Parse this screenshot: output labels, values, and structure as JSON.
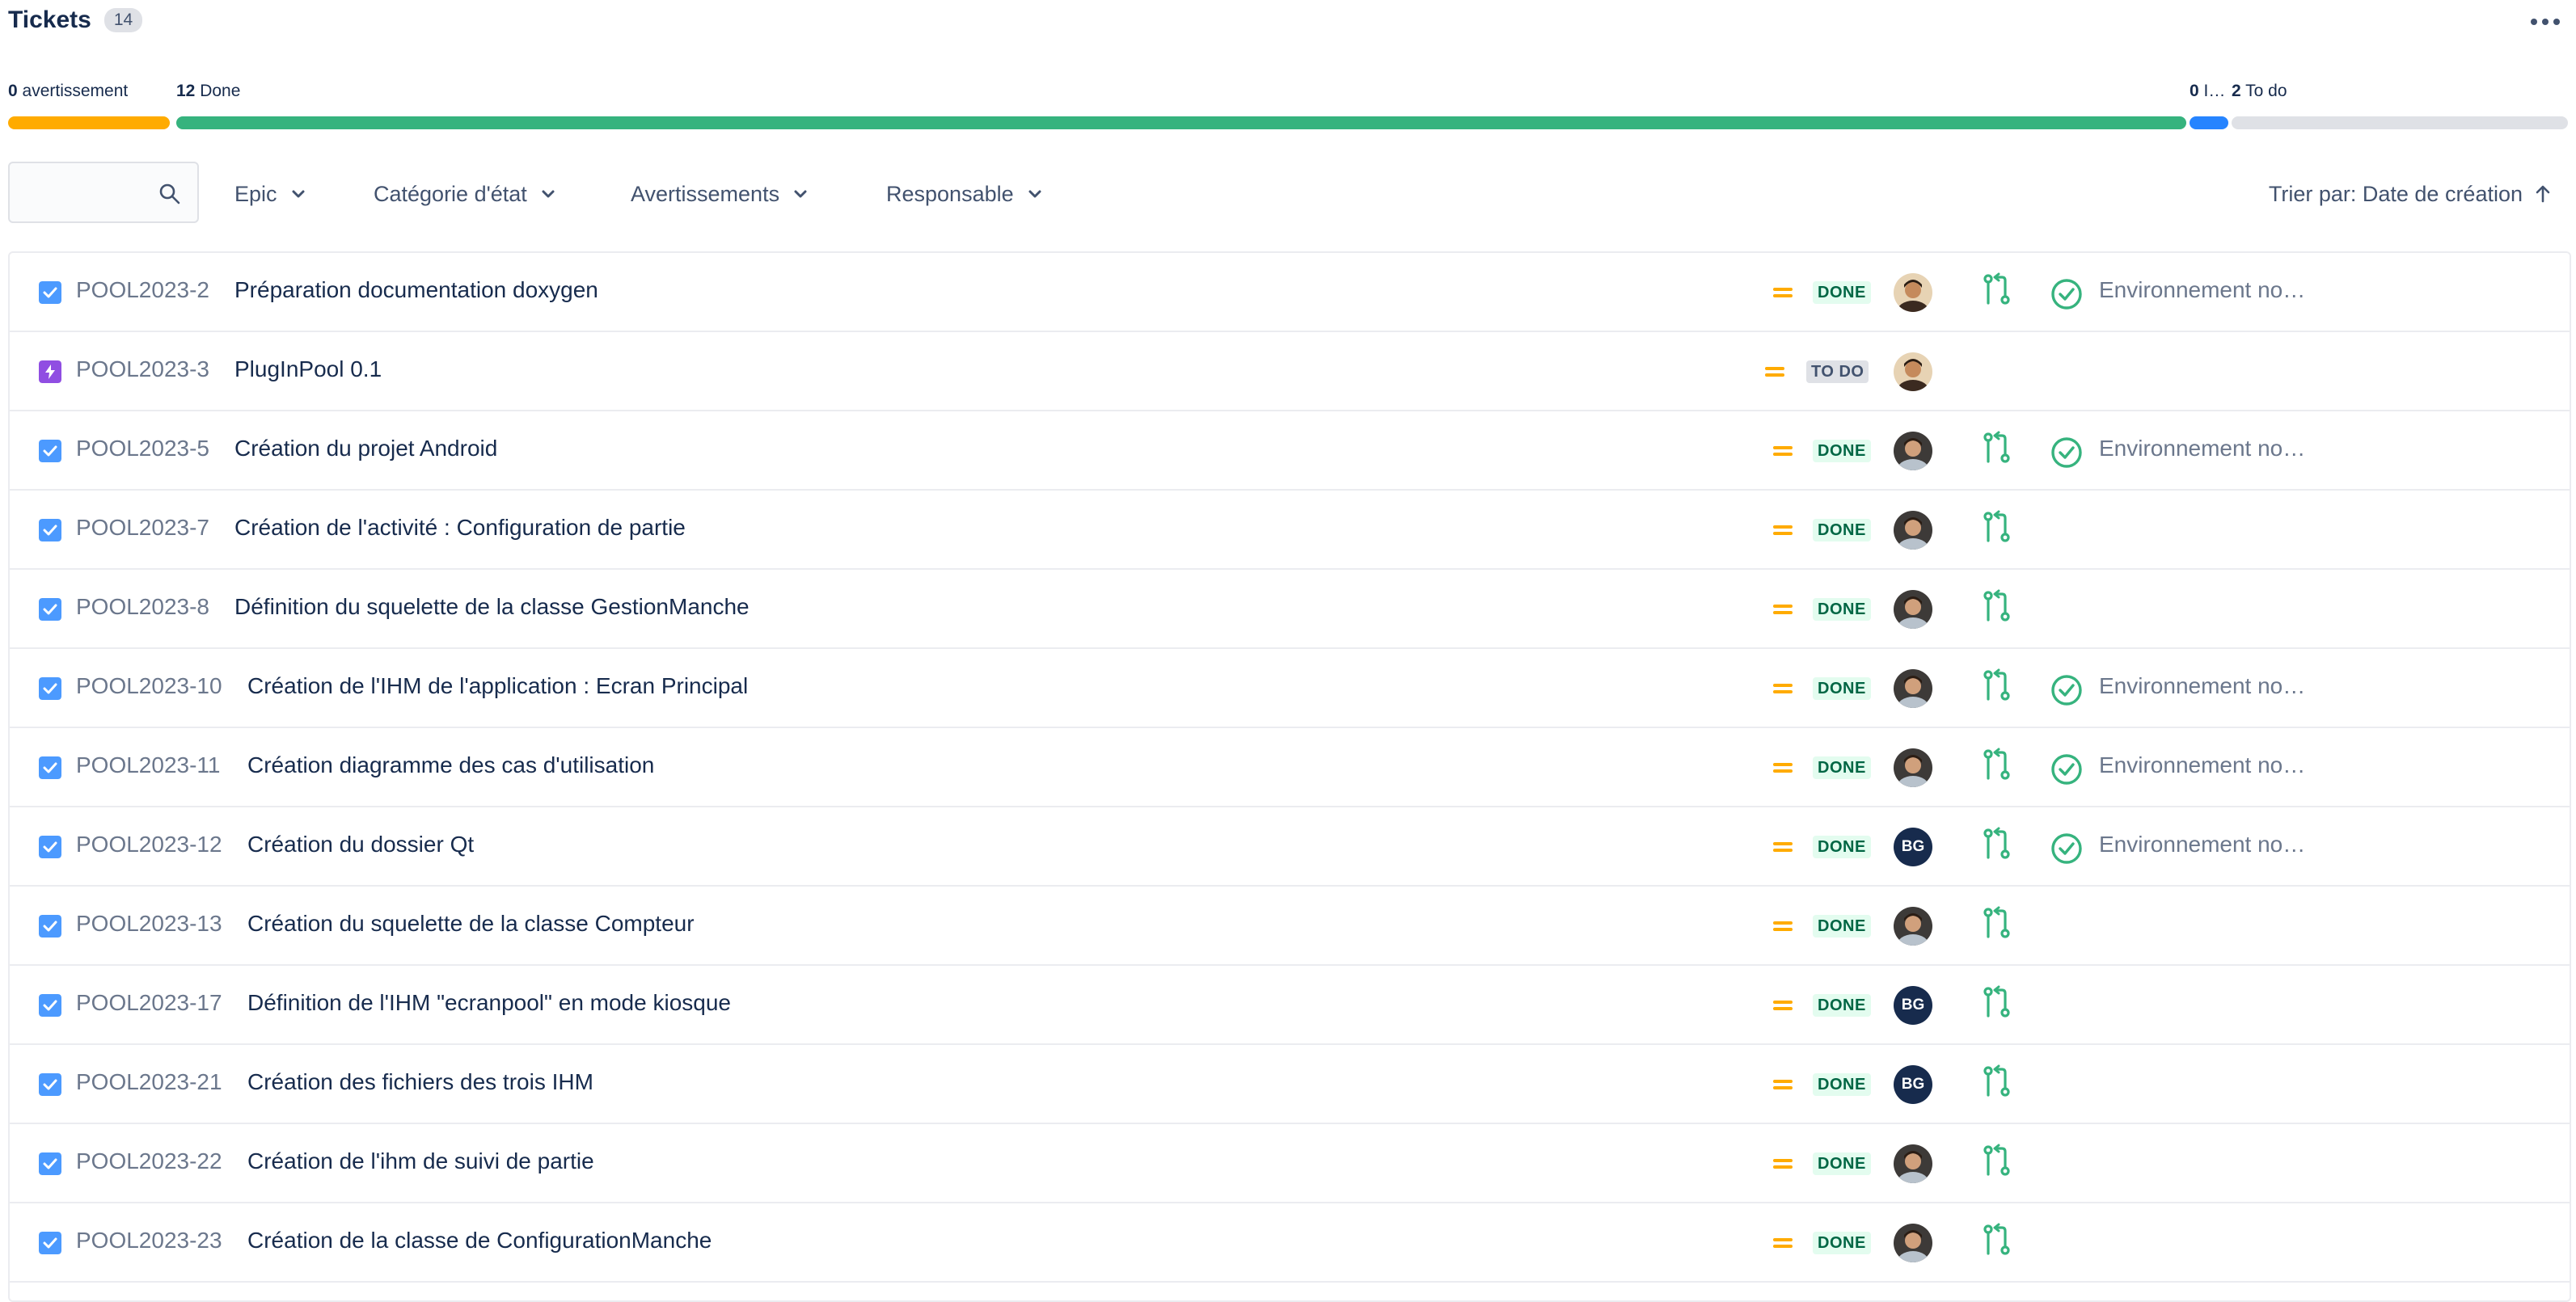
{
  "header": {
    "title": "Tickets",
    "count": "14"
  },
  "progress": {
    "segments": [
      {
        "count": "0",
        "label": "avertissement",
        "color": "#ffab00"
      },
      {
        "count": "12",
        "label": "Done",
        "color": "#36b37e"
      },
      {
        "count": "0",
        "label": "I…",
        "color": "#2684ff"
      },
      {
        "count": "2",
        "label": "To do",
        "color": "#dfe1e6"
      }
    ]
  },
  "filters": {
    "search_placeholder": "",
    "epic": "Epic",
    "state_category": "Catégorie d'état",
    "warnings": "Avertissements",
    "assignee": "Responsable",
    "sort": "Trier par: Date de création"
  },
  "colors": {
    "done_bg": "#e3fcef",
    "done_text": "#006644",
    "priority": "#ffab00",
    "accent_green": "#36b37e",
    "task_blue": "#4c9aff",
    "epic_purple": "#904ee2"
  },
  "tickets": [
    {
      "type": "task",
      "key": "POOL2023-2",
      "summary": "Préparation documentation doxygen",
      "status": "DONE",
      "avatar": "photo-dark",
      "dev": true,
      "env": "Environnement no…"
    },
    {
      "type": "epic",
      "key": "POOL2023-3",
      "summary": "PlugInPool 0.1",
      "status": "TO DO",
      "avatar": "photo-dark",
      "dev": false,
      "env": ""
    },
    {
      "type": "task",
      "key": "POOL2023-5",
      "summary": "Création du projet Android",
      "status": "DONE",
      "avatar": "photo-light",
      "dev": true,
      "env": "Environnement no…"
    },
    {
      "type": "task",
      "key": "POOL2023-7",
      "summary": "Création de l'activité : Configuration de partie",
      "status": "DONE",
      "avatar": "photo-light",
      "dev": true,
      "env": ""
    },
    {
      "type": "task",
      "key": "POOL2023-8",
      "summary": "Définition du squelette de la classe GestionManche",
      "status": "DONE",
      "avatar": "photo-light",
      "dev": true,
      "env": ""
    },
    {
      "type": "task",
      "key": "POOL2023-10",
      "summary": "Création de l'IHM de l'application : Ecran Principal",
      "status": "DONE",
      "avatar": "photo-light",
      "dev": true,
      "env": "Environnement no…"
    },
    {
      "type": "task",
      "key": "POOL2023-11",
      "summary": "Création diagramme des cas d'utilisation",
      "status": "DONE",
      "avatar": "photo-light",
      "dev": true,
      "env": "Environnement no…"
    },
    {
      "type": "task",
      "key": "POOL2023-12",
      "summary": "Création du dossier Qt",
      "status": "DONE",
      "avatar": "BG",
      "dev": true,
      "env": "Environnement no…"
    },
    {
      "type": "task",
      "key": "POOL2023-13",
      "summary": "Création du squelette de la classe Compteur",
      "status": "DONE",
      "avatar": "photo-light",
      "dev": true,
      "env": ""
    },
    {
      "type": "task",
      "key": "POOL2023-17",
      "summary": "Définition de l'IHM \"ecranpool\" en mode kiosque",
      "status": "DONE",
      "avatar": "BG",
      "dev": true,
      "env": ""
    },
    {
      "type": "task",
      "key": "POOL2023-21",
      "summary": "Création des fichiers des trois IHM",
      "status": "DONE",
      "avatar": "BG",
      "dev": true,
      "env": ""
    },
    {
      "type": "task",
      "key": "POOL2023-22",
      "summary": "Création de l'ihm de suivi de partie",
      "status": "DONE",
      "avatar": "photo-light",
      "dev": true,
      "env": ""
    },
    {
      "type": "task",
      "key": "POOL2023-23",
      "summary": "Création de la classe de ConfigurationManche",
      "status": "DONE",
      "avatar": "photo-light",
      "dev": true,
      "env": ""
    }
  ]
}
